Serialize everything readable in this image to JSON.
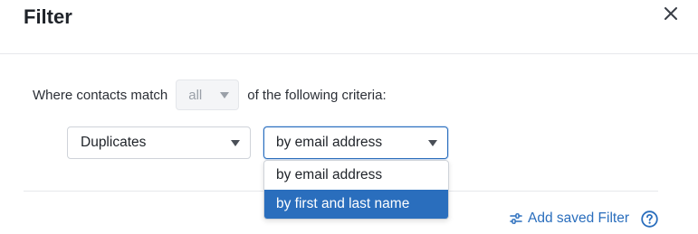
{
  "dialog": {
    "title": "Filter"
  },
  "criteria": {
    "prefix": "Where contacts match",
    "match_value": "all",
    "suffix": "of the following criteria:"
  },
  "rule": {
    "field": "Duplicates",
    "method": "by email address"
  },
  "dropdown": {
    "options": [
      {
        "label": "by email address",
        "selected": false
      },
      {
        "label": "by first and last name",
        "selected": true
      }
    ]
  },
  "footer": {
    "add_saved_filter": "Add saved Filter"
  },
  "colors": {
    "accent": "#2a6ebd",
    "text": "#1f2329",
    "muted": "#9aa0a8"
  },
  "icons": {
    "close": "close-icon",
    "caret": "caret-down-icon",
    "sliders": "sliders-icon",
    "help": "help-icon"
  }
}
